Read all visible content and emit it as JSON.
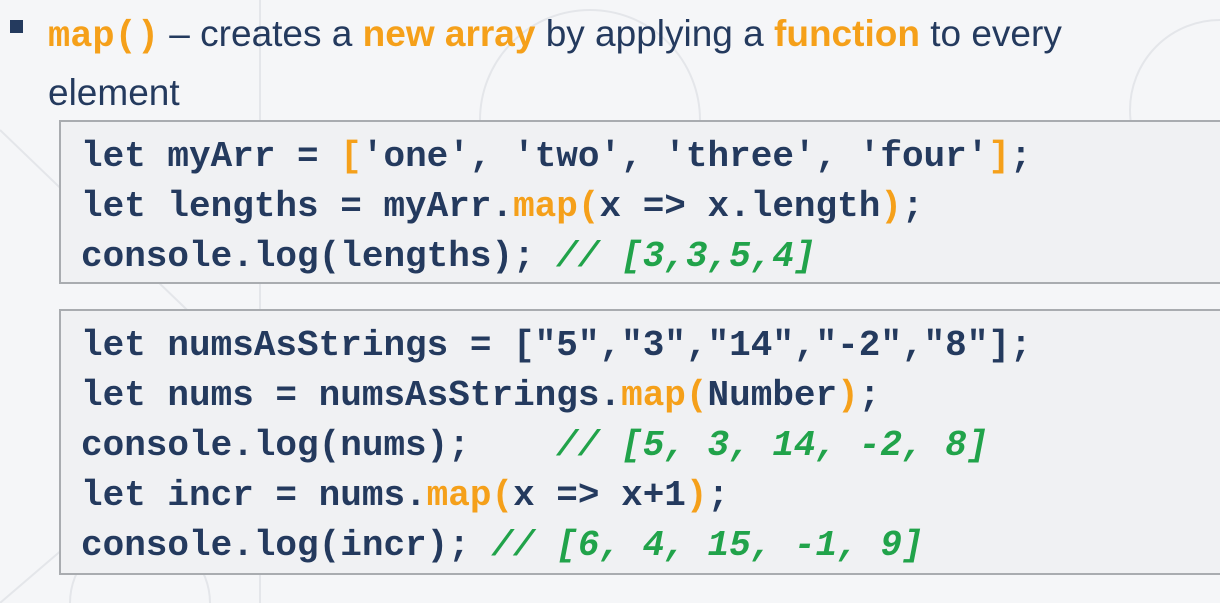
{
  "heading": {
    "method": "map()",
    "dash": " – creates a ",
    "hl1": "new array",
    "mid": " by applying a ",
    "hl2": "function",
    "end": " to every",
    "line2": "element"
  },
  "colors": {
    "text": "#243a5e",
    "accent": "#f5a01a",
    "comment": "#21a34a"
  },
  "code_blocks": [
    [
      [
        {
          "t": "let myArr = "
        },
        {
          "t": "[",
          "c": "orange"
        },
        {
          "t": "'one', 'two', 'three', 'four'"
        },
        {
          "t": "]",
          "c": "orange"
        },
        {
          "t": ";"
        }
      ],
      [
        {
          "t": "let lengths = myArr."
        },
        {
          "t": "map(",
          "c": "orange"
        },
        {
          "t": "x => x.length"
        },
        {
          "t": ")",
          "c": "orange"
        },
        {
          "t": ";"
        }
      ],
      [
        {
          "t": "console.log(lengths); "
        },
        {
          "t": "// [3,3,5,4]",
          "c": "comment"
        }
      ]
    ],
    [
      [
        {
          "t": "let numsAsStrings = [\"5\",\"3\",\"14\",\"-2\",\"8\"];"
        }
      ],
      [
        {
          "t": "let nums = numsAsStrings."
        },
        {
          "t": "map(",
          "c": "orange"
        },
        {
          "t": "Number"
        },
        {
          "t": ")",
          "c": "orange"
        },
        {
          "t": ";"
        }
      ],
      [
        {
          "t": "console.log(nums);    "
        },
        {
          "t": "// [5, 3, 14, -2, 8]",
          "c": "comment"
        }
      ],
      [
        {
          "t": "let incr = nums."
        },
        {
          "t": "map(",
          "c": "orange"
        },
        {
          "t": "x => x+1"
        },
        {
          "t": ")",
          "c": "orange"
        },
        {
          "t": ";"
        }
      ],
      [
        {
          "t": "console.log(incr); "
        },
        {
          "t": "// [6, 4, 15, -1, 9]",
          "c": "comment"
        }
      ]
    ]
  ]
}
